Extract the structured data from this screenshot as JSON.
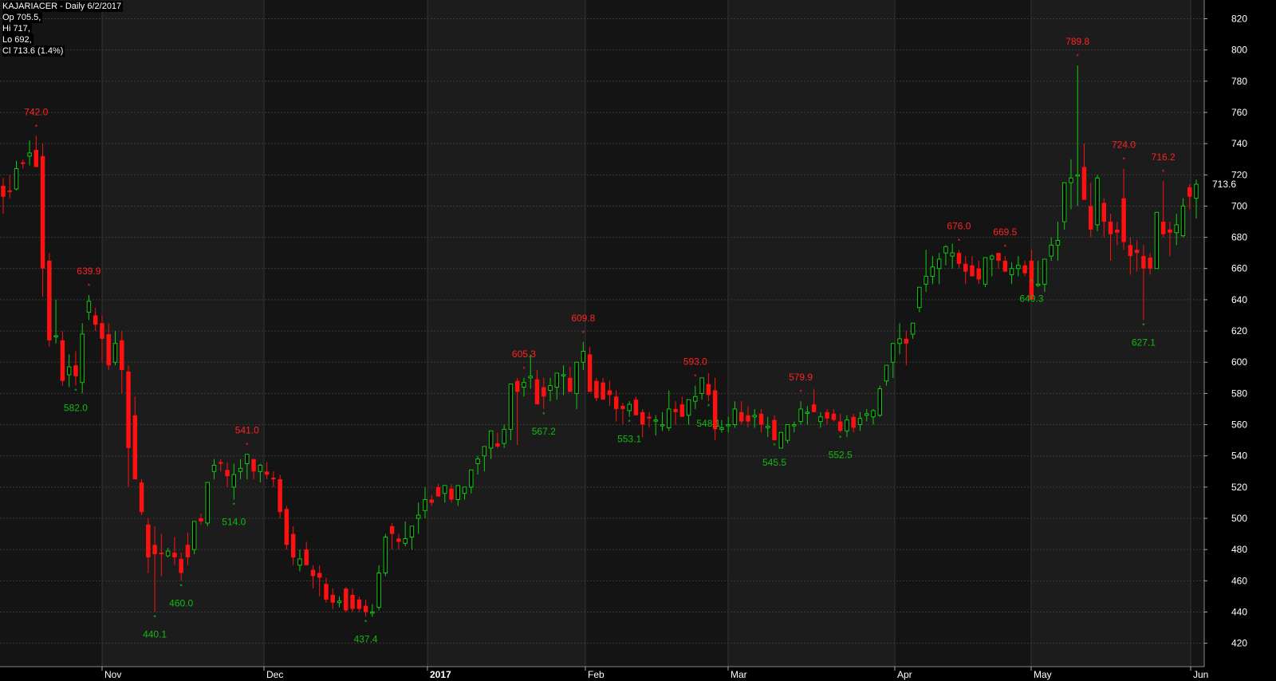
{
  "header": {
    "title": "KAJARIACER - Daily 6/2/2017",
    "open": "Op 705.5,",
    "high": "Hi 717,",
    "low": "Lo 692,",
    "close": "Cl 713.6 (1.4%)"
  },
  "chart_data": {
    "type": "candlestick",
    "ticker": "KAJARIACER",
    "ylim": [
      405,
      832
    ],
    "y_ticks": [
      420,
      440,
      460,
      480,
      500,
      520,
      540,
      560,
      580,
      600,
      620,
      640,
      660,
      680,
      700,
      720,
      740,
      760,
      780,
      800,
      820
    ],
    "x_labels": [
      "Nov",
      "Dec",
      "2017",
      "Feb",
      "Mar",
      "Apr",
      "May",
      "Jun"
    ],
    "last_price_label": "713.6",
    "colors": {
      "up": "#11cc11",
      "down": "#ff1111",
      "background": "#000000",
      "band": "#1a1a1a",
      "grid": "#3a3a3a",
      "axis_text": "#ffffff"
    },
    "candles": [
      [
        713,
        718,
        695,
        706
      ],
      [
        710,
        720,
        705,
        709
      ],
      [
        711,
        729,
        710,
        724
      ],
      [
        728,
        730,
        724,
        727
      ],
      [
        732,
        742,
        726,
        734
      ],
      [
        736,
        745,
        730,
        725
      ],
      [
        732,
        740,
        642,
        660
      ],
      [
        665,
        670,
        610,
        614
      ],
      [
        617,
        640,
        612,
        617
      ],
      [
        614,
        620,
        585,
        588
      ],
      [
        592,
        605,
        584,
        597
      ],
      [
        598,
        607,
        585,
        591
      ],
      [
        587,
        625,
        580,
        618
      ],
      [
        632,
        643,
        627,
        639
      ],
      [
        630,
        635,
        620,
        624
      ],
      [
        625,
        630,
        600,
        615
      ],
      [
        618,
        625,
        595,
        598
      ],
      [
        600,
        620,
        598,
        612
      ],
      [
        614,
        620,
        580,
        595
      ],
      [
        594,
        598,
        520,
        545
      ],
      [
        566,
        578,
        525,
        525
      ],
      [
        523,
        525,
        502,
        504
      ],
      [
        496,
        500,
        465,
        475
      ],
      [
        483,
        495,
        440,
        477
      ],
      [
        478,
        490,
        463,
        477
      ],
      [
        476,
        481,
        475,
        479
      ],
      [
        478,
        488,
        470,
        475
      ],
      [
        474,
        478,
        460,
        465
      ],
      [
        483,
        491,
        470,
        475
      ],
      [
        480,
        495,
        477,
        498
      ],
      [
        500,
        503,
        496,
        498
      ],
      [
        497,
        523,
        495,
        523
      ],
      [
        530,
        538,
        525,
        534
      ],
      [
        536,
        538,
        530,
        535
      ],
      [
        531,
        536,
        520,
        527
      ],
      [
        520,
        535,
        512,
        528
      ],
      [
        530,
        538,
        525,
        532
      ],
      [
        535,
        541,
        525,
        541
      ],
      [
        538,
        536,
        525,
        530
      ],
      [
        530,
        535,
        523,
        534
      ],
      [
        530,
        536,
        525,
        528
      ],
      [
        526,
        530,
        520,
        525
      ],
      [
        525,
        528,
        500,
        504
      ],
      [
        506,
        508,
        480,
        483
      ],
      [
        490,
        495,
        470,
        475
      ],
      [
        470,
        480,
        466,
        474
      ],
      [
        480,
        485,
        470,
        470
      ],
      [
        467,
        470,
        455,
        463
      ],
      [
        465,
        470,
        450,
        462
      ],
      [
        458,
        462,
        446,
        448
      ],
      [
        451,
        455,
        442,
        446
      ],
      [
        446,
        450,
        443,
        447
      ],
      [
        455,
        456,
        440,
        441
      ],
      [
        451,
        455,
        440,
        442
      ],
      [
        448,
        450,
        440,
        442
      ],
      [
        444,
        448,
        437,
        440
      ],
      [
        440,
        445,
        437,
        440
      ],
      [
        443,
        470,
        441,
        465
      ],
      [
        465,
        490,
        463,
        488
      ],
      [
        495,
        497,
        480,
        490
      ],
      [
        487,
        490,
        480,
        485
      ],
      [
        484,
        498,
        482,
        487
      ],
      [
        488,
        494,
        480,
        495
      ],
      [
        500,
        510,
        490,
        502
      ],
      [
        505,
        520,
        500,
        512
      ],
      [
        512,
        515,
        508,
        510
      ],
      [
        520,
        522,
        515,
        514
      ],
      [
        516,
        520,
        510,
        521
      ],
      [
        519,
        522,
        510,
        512
      ],
      [
        512,
        520,
        508,
        521
      ],
      [
        516,
        518,
        512,
        520
      ],
      [
        520,
        526,
        516,
        531
      ],
      [
        535,
        540,
        528,
        538
      ],
      [
        540,
        545,
        530,
        546
      ],
      [
        545,
        550,
        538,
        556
      ],
      [
        548,
        555,
        545,
        546
      ],
      [
        548,
        560,
        545,
        557
      ],
      [
        557,
        566,
        550,
        586
      ],
      [
        588,
        590,
        547,
        581
      ],
      [
        584,
        590,
        578,
        587
      ],
      [
        590,
        605,
        583,
        591
      ],
      [
        589,
        595,
        580,
        573
      ],
      [
        584,
        590,
        570,
        578
      ],
      [
        582,
        590,
        575,
        585
      ],
      [
        584,
        588,
        576,
        593
      ],
      [
        592,
        598,
        579,
        592
      ],
      [
        590,
        597,
        584,
        581
      ],
      [
        580,
        584,
        570,
        600
      ],
      [
        600,
        613,
        595,
        607
      ],
      [
        605,
        610,
        582,
        581
      ],
      [
        588,
        590,
        575,
        577
      ],
      [
        587,
        590,
        578,
        576
      ],
      [
        582,
        588,
        572,
        579
      ],
      [
        578,
        582,
        562,
        570
      ],
      [
        572,
        574,
        560,
        570
      ],
      [
        569,
        575,
        565,
        573
      ],
      [
        576,
        578,
        568,
        566
      ],
      [
        568,
        570,
        552,
        560
      ],
      [
        565,
        568,
        558,
        564
      ],
      [
        563,
        566,
        553,
        563
      ],
      [
        560,
        568,
        556,
        560
      ],
      [
        558,
        582,
        556,
        570
      ],
      [
        570,
        575,
        560,
        568
      ],
      [
        573,
        578,
        565,
        565
      ],
      [
        566,
        576,
        560,
        576
      ],
      [
        575,
        585,
        570,
        578
      ],
      [
        580,
        590,
        576,
        590
      ],
      [
        586,
        593,
        575,
        579
      ],
      [
        582,
        590,
        550,
        557
      ],
      [
        557,
        563,
        555,
        558
      ],
      [
        560,
        565,
        555,
        560
      ],
      [
        560,
        575,
        558,
        570
      ],
      [
        568,
        575,
        560,
        562
      ],
      [
        566,
        572,
        558,
        562
      ],
      [
        565,
        570,
        558,
        566
      ],
      [
        567,
        570,
        555,
        560
      ],
      [
        558,
        565,
        552,
        559
      ],
      [
        563,
        566,
        550,
        550
      ],
      [
        545,
        550,
        545,
        555
      ],
      [
        550,
        560,
        548,
        560
      ],
      [
        560,
        562,
        555,
        560
      ],
      [
        562,
        575,
        560,
        570
      ],
      [
        568,
        572,
        560,
        568
      ],
      [
        573,
        583,
        568,
        568
      ],
      [
        562,
        568,
        558,
        565
      ],
      [
        568,
        570,
        560,
        564
      ],
      [
        567,
        570,
        562,
        563
      ],
      [
        562,
        567,
        555,
        556
      ],
      [
        556,
        566,
        552,
        563
      ],
      [
        565,
        567,
        555,
        558
      ],
      [
        560,
        568,
        556,
        564
      ],
      [
        566,
        570,
        562,
        567
      ],
      [
        565,
        570,
        560,
        569
      ],
      [
        566,
        585,
        565,
        583
      ],
      [
        588,
        593,
        585,
        598
      ],
      [
        600,
        608,
        590,
        612
      ],
      [
        612,
        625,
        605,
        615
      ],
      [
        615,
        620,
        598,
        612
      ],
      [
        618,
        622,
        615,
        625
      ],
      [
        635,
        640,
        632,
        648
      ],
      [
        650,
        672,
        645,
        655
      ],
      [
        655,
        668,
        650,
        661
      ],
      [
        660,
        670,
        650,
        666
      ],
      [
        670,
        675,
        662,
        674
      ],
      [
        668,
        676,
        660,
        670
      ],
      [
        670,
        672,
        660,
        663
      ],
      [
        663,
        668,
        650,
        658
      ],
      [
        662,
        668,
        655,
        655
      ],
      [
        660,
        665,
        650,
        653
      ],
      [
        650,
        665,
        648,
        667
      ],
      [
        666,
        669,
        655,
        668
      ],
      [
        670,
        668,
        660,
        665
      ],
      [
        665,
        668,
        658,
        658
      ],
      [
        656,
        664,
        650,
        660
      ],
      [
        660,
        668,
        655,
        662
      ],
      [
        662,
        665,
        655,
        657
      ],
      [
        665,
        672,
        655,
        640
      ],
      [
        650,
        665,
        648,
        650
      ],
      [
        650,
        660,
        645,
        666
      ],
      [
        668,
        680,
        665,
        675
      ],
      [
        675,
        690,
        665,
        678
      ],
      [
        690,
        695,
        685,
        715
      ],
      [
        715,
        730,
        698,
        718
      ],
      [
        720,
        790,
        700,
        720
      ],
      [
        725,
        740,
        705,
        704
      ],
      [
        700,
        715,
        680,
        685
      ],
      [
        688,
        720,
        684,
        718
      ],
      [
        702,
        705,
        680,
        690
      ],
      [
        690,
        695,
        665,
        682
      ],
      [
        685,
        690,
        675,
        683
      ],
      [
        705,
        724,
        672,
        677
      ],
      [
        675,
        680,
        656,
        668
      ],
      [
        672,
        678,
        658,
        670
      ],
      [
        668,
        675,
        627,
        660
      ],
      [
        667,
        670,
        656,
        660
      ],
      [
        660,
        670,
        660,
        696
      ],
      [
        690,
        716,
        680,
        682
      ],
      [
        685,
        690,
        668,
        683
      ],
      [
        683,
        695,
        675,
        688
      ],
      [
        681,
        705,
        680,
        700
      ],
      [
        712,
        714,
        698,
        706
      ],
      [
        705,
        717,
        692,
        714
      ]
    ],
    "annotations": [
      {
        "label": "742.0",
        "type": "high",
        "i": 5
      },
      {
        "label": "639.9",
        "type": "high",
        "i": 13
      },
      {
        "label": "582.0",
        "type": "low",
        "i": 11
      },
      {
        "label": "440.1",
        "type": "low",
        "i": 23
      },
      {
        "label": "460.0",
        "type": "low",
        "i": 27
      },
      {
        "label": "514.0",
        "type": "low",
        "i": 35
      },
      {
        "label": "541.0",
        "type": "high",
        "i": 37
      },
      {
        "label": "437.4",
        "type": "low",
        "i": 55
      },
      {
        "label": "605.3",
        "type": "high",
        "i": 79
      },
      {
        "label": "567.2",
        "type": "low",
        "i": 82
      },
      {
        "label": "609.8",
        "type": "high",
        "i": 88
      },
      {
        "label": "553.1",
        "type": "low",
        "i": 95
      },
      {
        "label": "593.0",
        "type": "high",
        "i": 105
      },
      {
        "label": "548.1",
        "type": "low",
        "i": 107
      },
      {
        "label": "545.5",
        "type": "low",
        "i": 117
      },
      {
        "label": "579.9",
        "type": "high",
        "i": 121
      },
      {
        "label": "552.5",
        "type": "low",
        "i": 127
      },
      {
        "label": "676.0",
        "type": "high",
        "i": 145
      },
      {
        "label": "669.5",
        "type": "high",
        "i": 152
      },
      {
        "label": "640.3",
        "type": "low",
        "i": 156
      },
      {
        "label": "789.8",
        "type": "high",
        "i": 163
      },
      {
        "label": "724.0",
        "type": "high",
        "i": 170
      },
      {
        "label": "627.1",
        "type": "low",
        "i": 173
      },
      {
        "label": "716.2",
        "type": "high",
        "i": 176
      }
    ]
  }
}
